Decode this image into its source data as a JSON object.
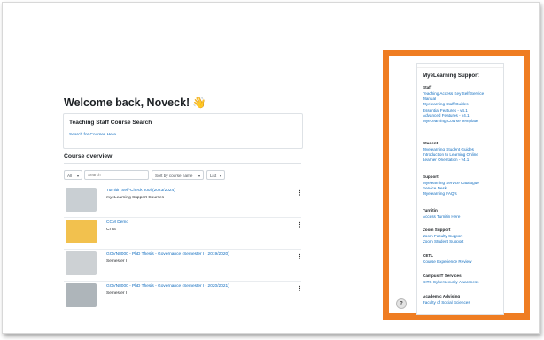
{
  "welcome": {
    "title": "Welcome back, Noveck!",
    "emoji": "👋"
  },
  "search_block": {
    "heading": "Teaching Staff Course Search",
    "link": "Search for Courses Here"
  },
  "overview": {
    "title": "Course overview",
    "filter": "All",
    "search_placeholder": "Search",
    "sort": "Sort by course name",
    "view": "List"
  },
  "courses": [
    {
      "name": "Turnitin Self-Check Tool (2023/2024)",
      "category": "myeLearning Support Courses",
      "color": "#c9cfd3"
    },
    {
      "name": "CCM Demo",
      "category": "CITS",
      "color": "#f2c14e"
    },
    {
      "name": "GOVN8000 - PhD Thesis - Governance (Semester I - 2019/2020)",
      "category": "Semester I",
      "color": "#cdd1d4"
    },
    {
      "name": "GOVN8000 - PhD Thesis - Governance (Semester I - 2020/2021)",
      "category": "Semester I",
      "color": "#aeb5ba"
    }
  ],
  "sidebar": {
    "title": "MyeLearning Support",
    "sections": [
      {
        "heading": "Staff",
        "links": [
          "Teaching Access Key Self Service",
          "Manual",
          "Myelearning Staff Guides",
          "Essential Features - v4.1",
          "Advanced Features - v4.1",
          "MyeLearning Course Template"
        ]
      },
      {
        "heading": "Student",
        "links": [
          "Myelearning Student Guides",
          "Introduction to Learning Online",
          "Learner Orientation - v4.1"
        ]
      },
      {
        "heading": "Support",
        "links": [
          "Myelearning Service Catalogue",
          "Service Desk",
          "Myelearning FAQ's"
        ]
      },
      {
        "heading": "Turnitin",
        "links": [
          "Access Turnitin Here"
        ]
      },
      {
        "heading": "Zoom Support",
        "links": [
          "Zoom Faculty Support",
          "Zoom Student Support"
        ]
      },
      {
        "heading": "CETL",
        "links": [
          "Course Experience Review"
        ]
      },
      {
        "heading": "Campus IT Services",
        "links": [
          "CITS Cybersecurity Awareness"
        ]
      },
      {
        "heading": "Academic Advising",
        "links": [
          "Faculty of Social Sciences"
        ]
      }
    ]
  },
  "help_button": "?",
  "colors": {
    "accent_orange": "#ef7d22",
    "link_blue": "#0f6cbf"
  }
}
